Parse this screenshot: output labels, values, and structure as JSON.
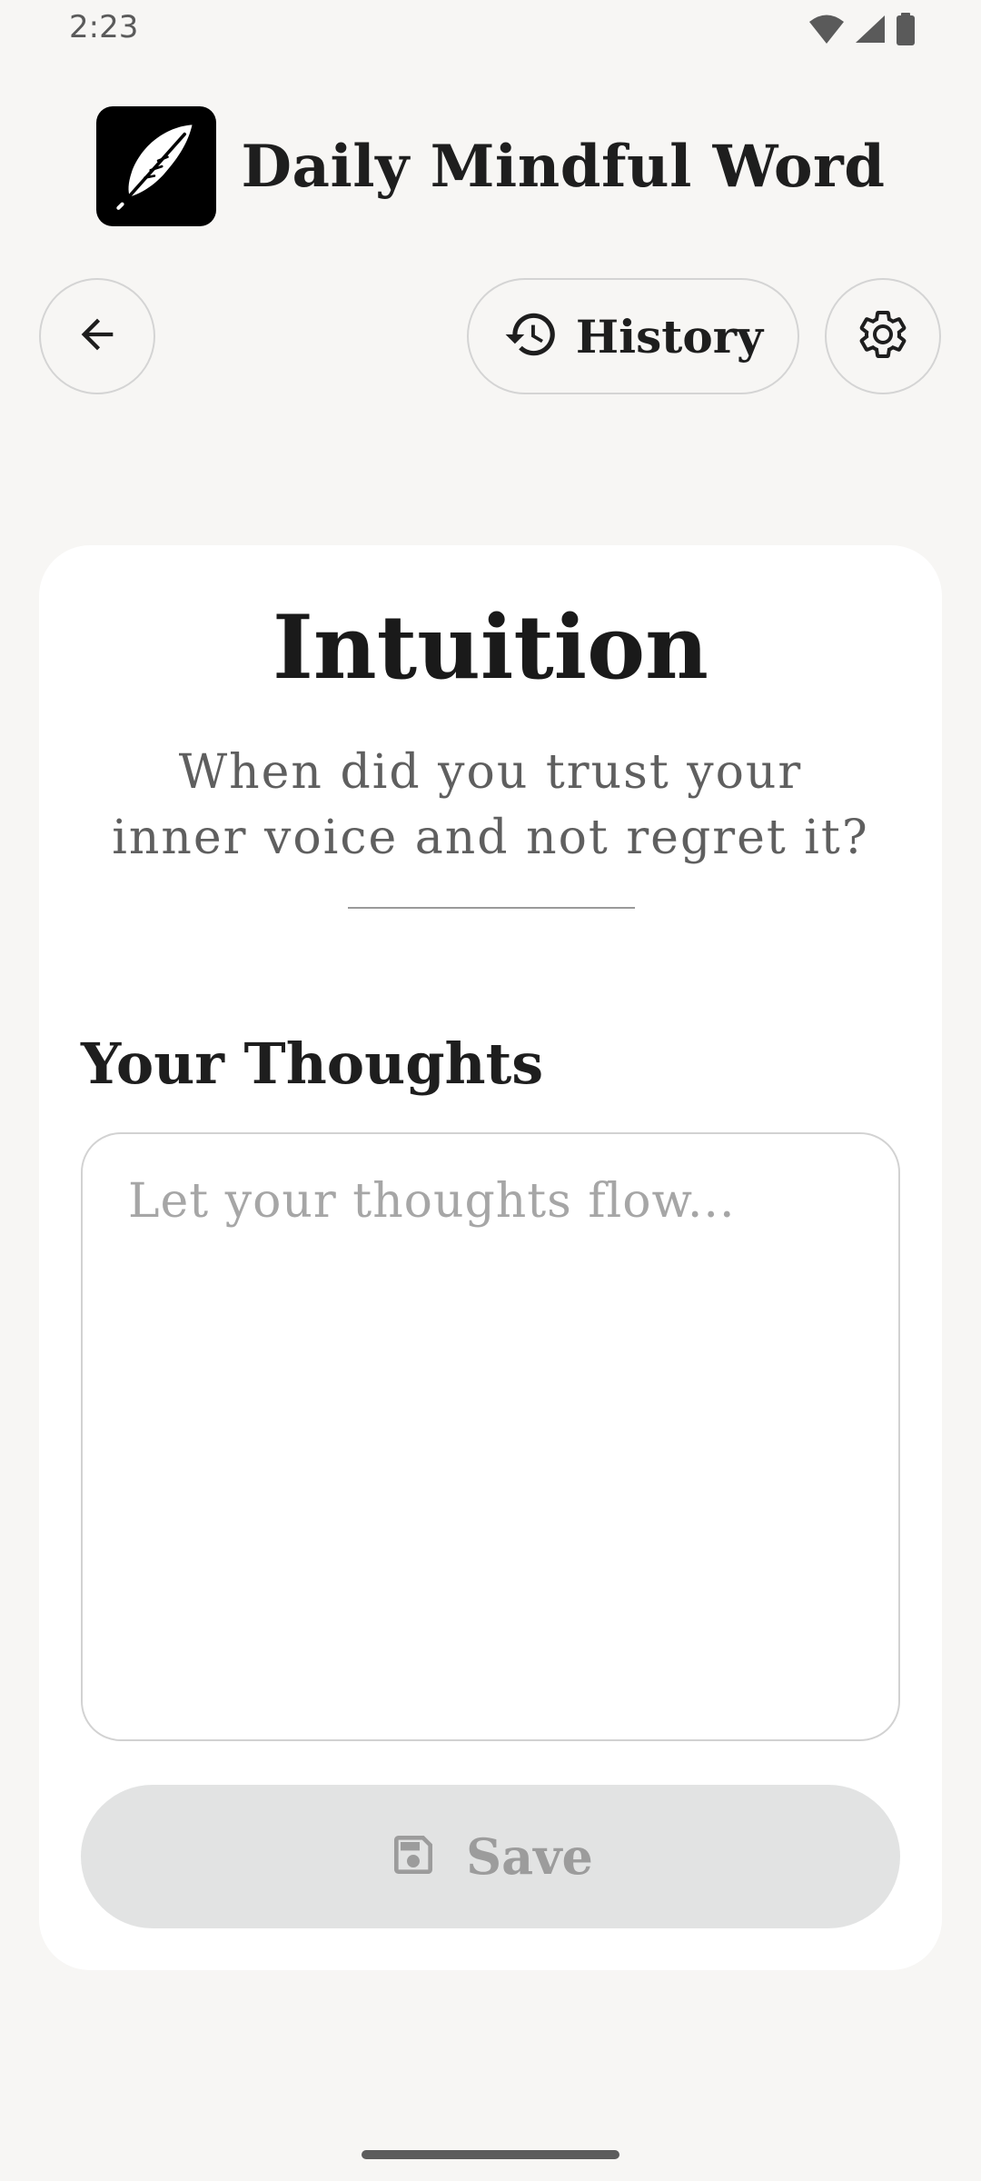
{
  "status_bar": {
    "time": "2:23",
    "icons": [
      "wifi-icon",
      "cellular-signal-icon",
      "battery-icon"
    ]
  },
  "header": {
    "app_title": "Daily Mindful Word",
    "logo_icon": "feather-icon"
  },
  "toolbar": {
    "back_icon": "arrow-left-icon",
    "history_label": "History",
    "history_icon": "history-icon",
    "settings_icon": "gear-icon"
  },
  "card": {
    "word": "Intuition",
    "prompt": "When did you trust your inner voice and not regret it?",
    "section_label": "Your Thoughts",
    "thoughts_value": "",
    "thoughts_placeholder": "Let your thoughts flow...",
    "save_label": "Save",
    "save_icon": "save-icon",
    "save_enabled": false
  },
  "colors": {
    "background": "#f7f6f4",
    "card": "#ffffff",
    "text_primary": "#1e1e1e",
    "text_secondary": "#5f5f5f",
    "disabled_button": "#e2e3e3",
    "disabled_text": "#9c9c9c"
  }
}
